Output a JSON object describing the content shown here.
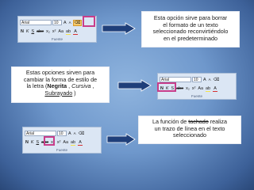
{
  "callouts": {
    "clear_format": {
      "line1": "Esta opción sirve para borrar",
      "line2": "el formato de un texto",
      "line3": "seleccionado reconvirtiéndolo",
      "line4": "en el predeterminado"
    },
    "styles": {
      "line1": "Estas opciones sirven para",
      "line2": "cambiar la forma de estilo de",
      "line3a": "la letra (",
      "bold": "Negrita",
      "sep1": " , ",
      "italic": "Cursiva",
      "sep2": " ,",
      "underline": "Subrayado",
      "tail": " )"
    },
    "strikethrough": {
      "pre": "La función de ",
      "word": "tachado",
      "post": " realiza",
      "line2": "un trazo de línea en el texto",
      "line3": "seleccionado"
    }
  },
  "toolbar": {
    "font_name": "Arial",
    "font_size": "10",
    "grow": "A",
    "shrink": "A",
    "clear": "⌫",
    "bold": "N",
    "italic": "K",
    "underline": "S",
    "strike": "abe",
    "sub": "x₂",
    "sup": "x²",
    "case": "Aa",
    "highlight": "ab",
    "color": "A",
    "group": "Fuente"
  },
  "colors": {
    "highlight_frame": "#c83d8a",
    "arrow": "#1f3f7a",
    "background": "#6f98cc"
  }
}
